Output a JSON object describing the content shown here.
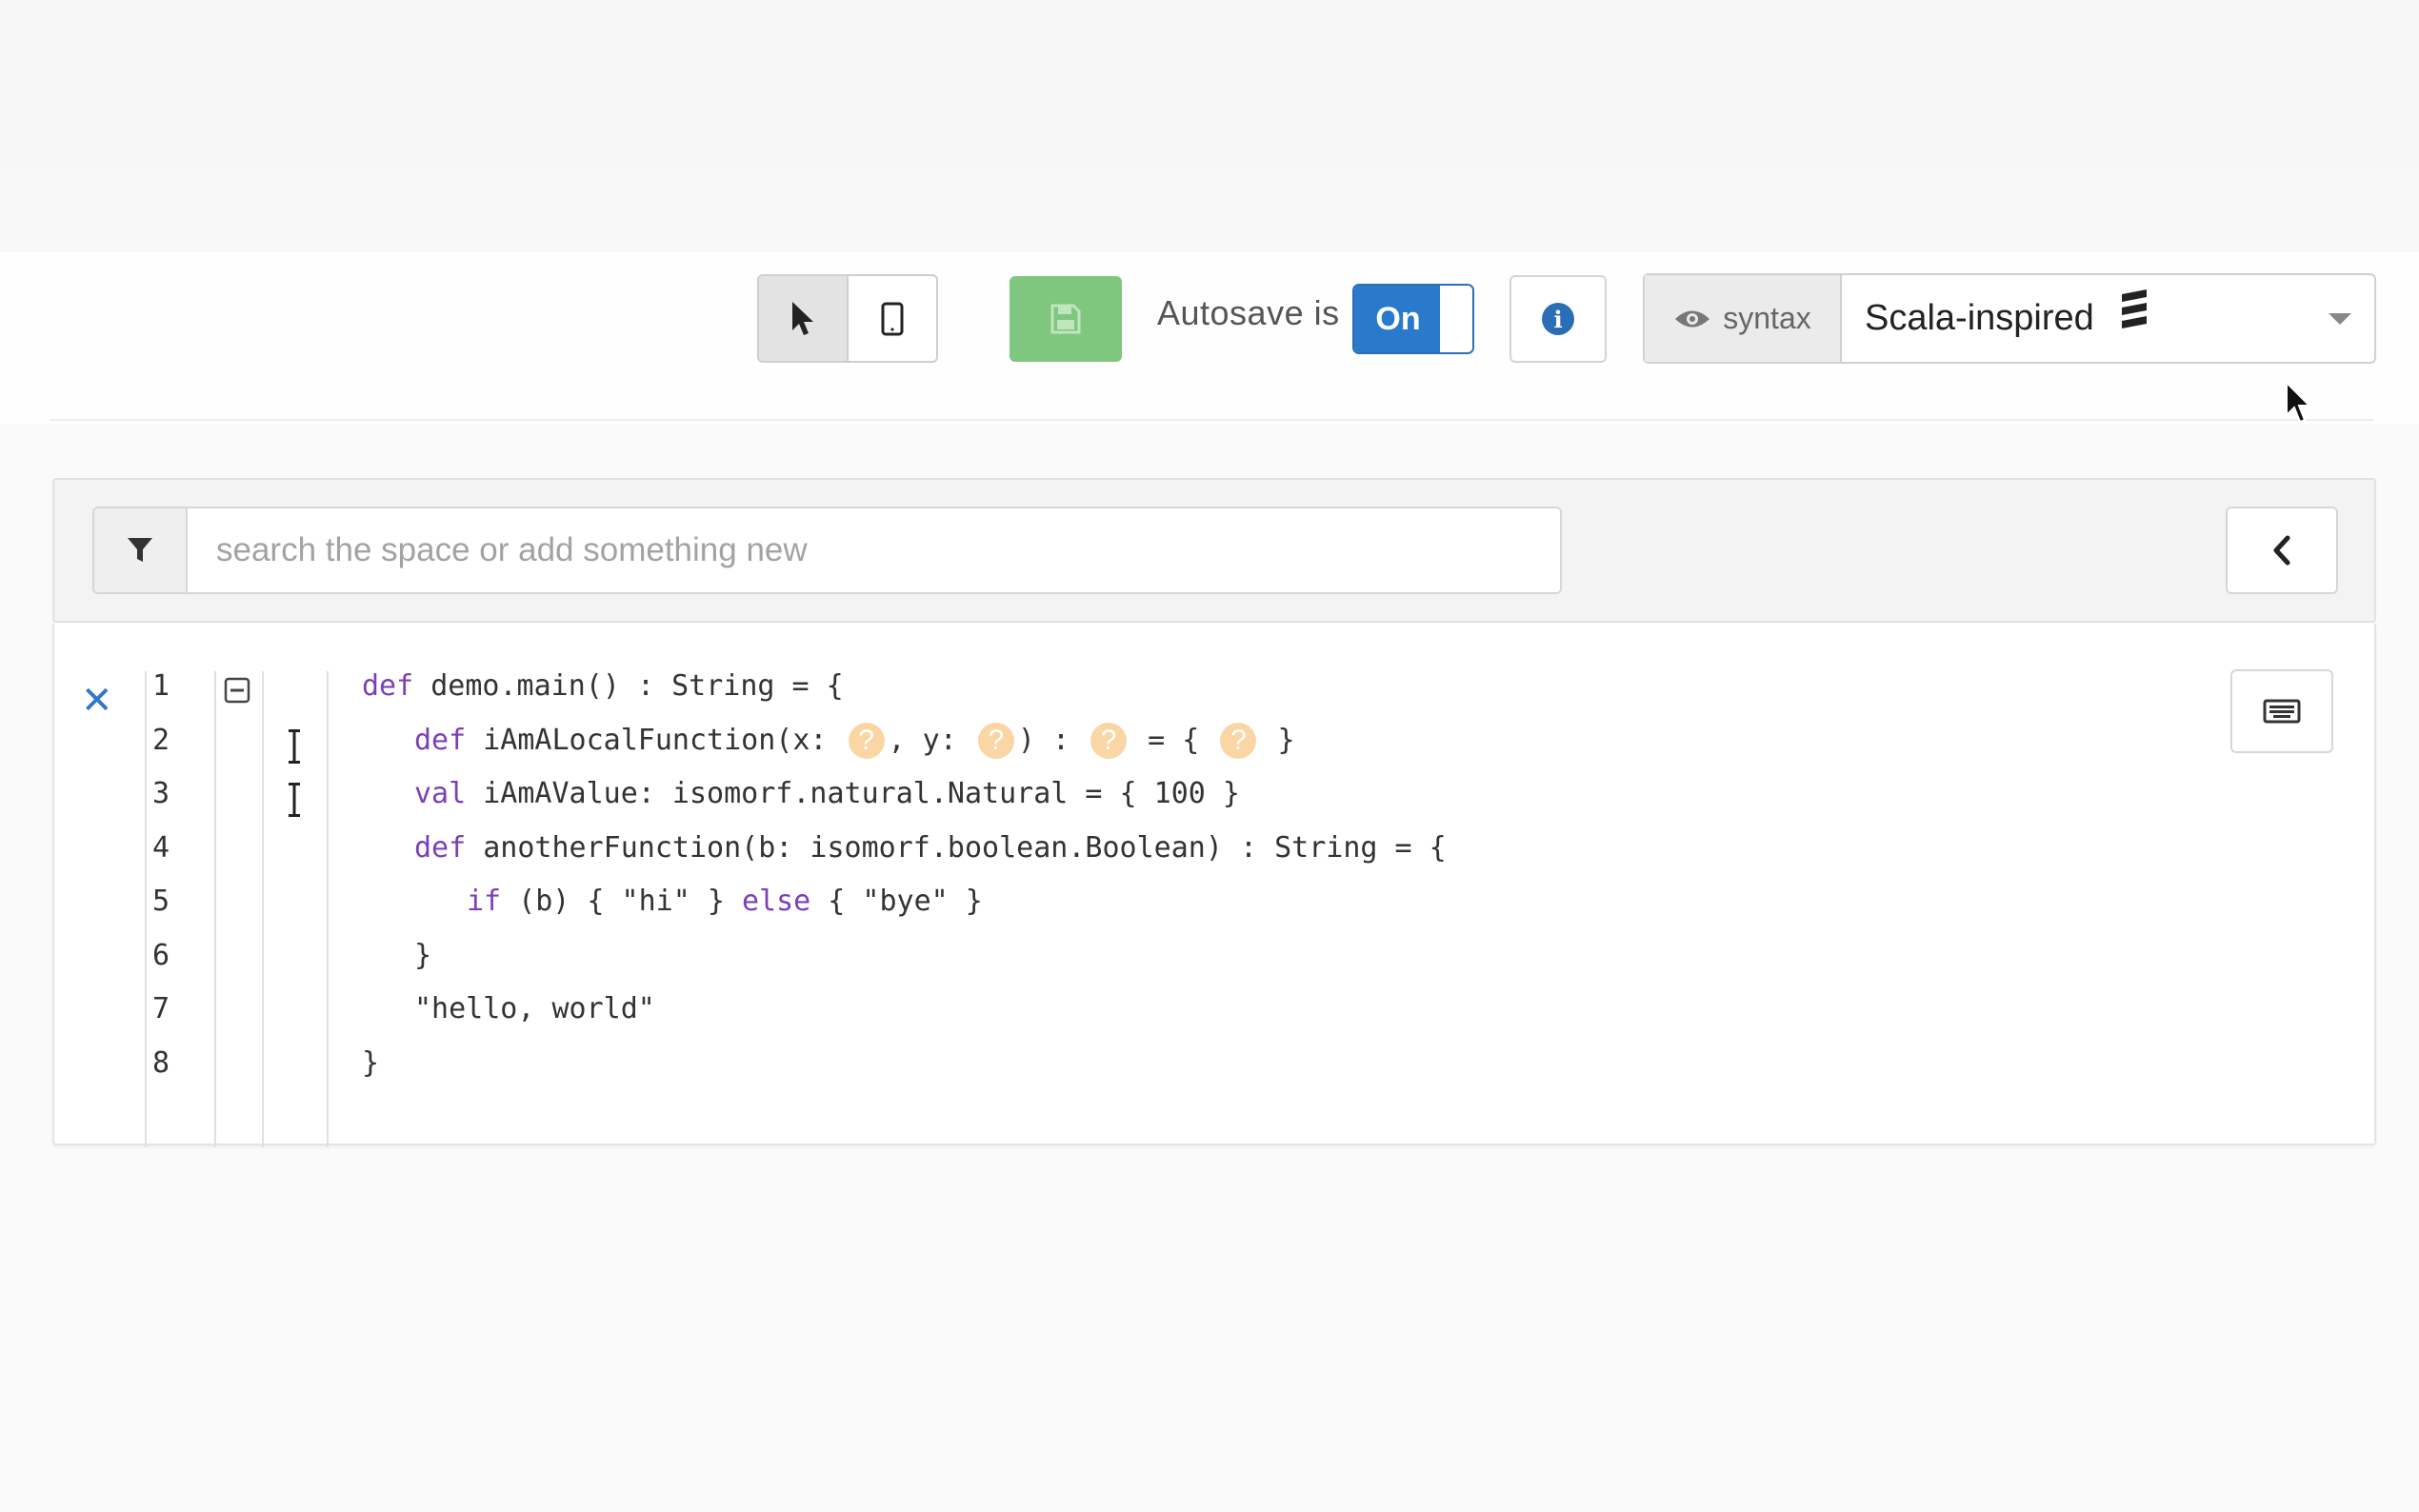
{
  "toolbar": {
    "autosave_label": "Autosave is",
    "autosave_toggle": "On",
    "syntax_label": "syntax",
    "syntax_selected": "Scala-inspired"
  },
  "search": {
    "placeholder": "search the space or add something new",
    "value": ""
  },
  "editor": {
    "lines": [
      {
        "num": "1",
        "indent": 0,
        "tokens": [
          {
            "t": "def",
            "kw": true
          },
          {
            "t": " demo.main() : String = {"
          }
        ]
      },
      {
        "num": "2",
        "indent": 1,
        "tokens": [
          {
            "t": "def",
            "kw": true
          },
          {
            "t": " iAmALocalFunction(x: "
          },
          {
            "hole": "?"
          },
          {
            "t": ", y: "
          },
          {
            "hole": "?"
          },
          {
            "t": ") : "
          },
          {
            "hole": "?"
          },
          {
            "t": " = { "
          },
          {
            "hole": "?"
          },
          {
            "t": " }"
          }
        ]
      },
      {
        "num": "3",
        "indent": 1,
        "tokens": [
          {
            "t": "val",
            "kw": true
          },
          {
            "t": " iAmAValue: isomorf.natural.Natural = { 100 }"
          }
        ]
      },
      {
        "num": "4",
        "indent": 1,
        "tokens": [
          {
            "t": "def",
            "kw": true
          },
          {
            "t": " anotherFunction(b: isomorf.boolean.Boolean) : String = {"
          }
        ]
      },
      {
        "num": "5",
        "indent": 2,
        "tokens": [
          {
            "t": "if",
            "kw": true
          },
          {
            "t": " (b) { \"hi\" } "
          },
          {
            "t": "else",
            "kw": true
          },
          {
            "t": " { \"bye\" }"
          }
        ]
      },
      {
        "num": "6",
        "indent": 1,
        "tokens": [
          {
            "t": "}"
          }
        ]
      },
      {
        "num": "7",
        "indent": 1,
        "tokens": [
          {
            "t": "\"hello, world\""
          }
        ]
      },
      {
        "num": "8",
        "indent": 0,
        "tokens": [
          {
            "t": "}"
          }
        ]
      }
    ]
  },
  "colors": {
    "keyword": "#7b3fb8",
    "toggle_on": "#2a7acb",
    "save": "#7fc67f",
    "close": "#2f78c4",
    "hole": "#f9d6a4"
  }
}
